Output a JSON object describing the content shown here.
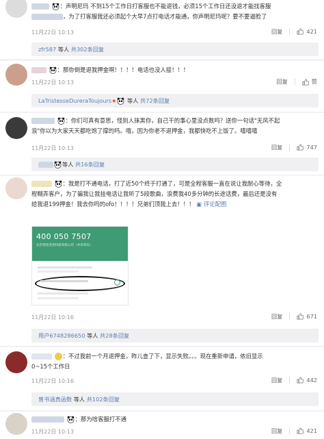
{
  "comments": [
    {
      "text_a": "：声明尼玛 不到15个工作日打客服也不能退钱，必须15个工作日还没退才能找客服",
      "text_b": "，为了打客服我还必须起个大早7点打电话才能通，你声明尼玛呢？要不要逼脸了",
      "time": "11月22日 10:13",
      "reply_label": "回复",
      "likes": "421"
    },
    {
      "text": "：那你倒是退我押金啊！！！！电话也没人接！！！",
      "time": "11月22日 10:13",
      "reply_label": "回复",
      "likes": "赞"
    },
    {
      "text_a": "：你们可真有意思，怪别人抹黑你，自己干的事心里没点数吗？送你一句话\"无风不起",
      "text_b": "浪\"你以为大家天天都吃饱了撑的吗。哦，因为你老不退押金，我都快吃不上饭了。嘻嘻嘻",
      "time": "11月22日 10:13",
      "reply_label": "回复",
      "likes": "747"
    },
    {
      "text_a": "：我是打不通电话，打了近50个终于打通了，可是全程客服一直在说让我耐心等待，全",
      "text_b": "程糊弄客户，为了骗我让我挂电话让我听了5段歌曲，浪费我40多分钟的长途话费，最后还是没有",
      "text_c": "给我退199押金！我去你吗的ofo！！！！兄弟们顶我上去！！！",
      "img_link": "评论配图",
      "time": "11月22日 10:16",
      "reply_label": "回复",
      "likes": "671"
    },
    {
      "text_a": "：不过我前一个月退押金，昨儿查了下，显示失败。。。现在重新申请，依旧显示",
      "text_b": "0~15个工作日",
      "time": "11月22日 10:16",
      "reply_label": "回复",
      "likes": "442"
    },
    {
      "text": "：那为啥客服打不通",
      "time": "11月22日 10:13",
      "reply_label": "回复",
      "likes": "421"
    }
  ],
  "reply_bars": [
    {
      "user": "zfr587",
      "mid": " 等人 ",
      "link": "共302条回复"
    },
    {
      "user": "LaTristesseDureraToujours",
      "mid": " 等人 ",
      "link": "共72条回复"
    },
    {
      "user": "",
      "mid": "等人 ",
      "link": "共16条回复"
    },
    {
      "user": "用户6748286650",
      "mid": " 等人 ",
      "link": "共28条回复"
    },
    {
      "user": "曾书涵真函数",
      "mid": " 等人 ",
      "link": "共102条回复"
    }
  ],
  "phone": {
    "number": "400 050 7507",
    "subtitle": "北京拜克洛克科技有限公司（共享单车）"
  },
  "colors": {
    "link": "#5d7fae",
    "name": "#eb7350",
    "muted": "#999999"
  }
}
